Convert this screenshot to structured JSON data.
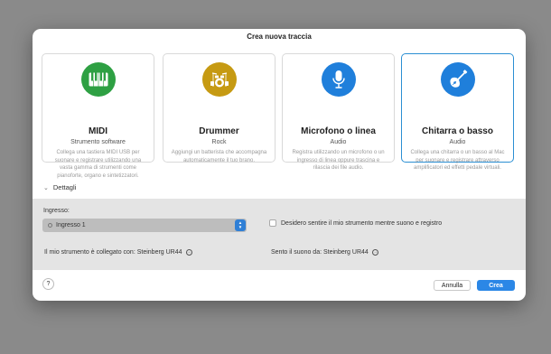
{
  "dialog": {
    "title": "Crea nuova traccia"
  },
  "cards": [
    {
      "title": "MIDI",
      "subtitle": "Strumento software",
      "description": "Collega una tastiera MIDI USB per suonare e registrare utilizzando una vasta gamma di strumenti come pianoforte, organo e sintetizzatori.",
      "icon": "piano-keys-icon",
      "color": "#2ea043"
    },
    {
      "title": "Drummer",
      "subtitle": "Rock",
      "description": "Aggiungi un batterista che accompagna automaticamente il tuo brano.",
      "icon": "drum-kit-icon",
      "color": "#c69a12"
    },
    {
      "title": "Microfono o linea",
      "subtitle": "Audio",
      "description": "Registra utilizzando un microfono o un ingresso di linea oppure trascina e rilascia dei file audio.",
      "icon": "microphone-icon",
      "color": "#1f7fdb"
    },
    {
      "title": "Chitarra o basso",
      "subtitle": "Audio",
      "description": "Collega una chitarra o un basso al Mac per suonare e registrare attraverso amplificatori ed effetti pedale virtuali.",
      "icon": "guitar-icon",
      "color": "#1f7fdb",
      "selected": true
    }
  ],
  "details": {
    "toggle_label": "Dettagli",
    "input_label": "Ingresso:",
    "input_value": "Ingresso 1",
    "monitor_label": "Desidero sentire il mio strumento mentre suono e registro",
    "monitor_checked": false,
    "device_in": "Il mio strumento è collegato con: Steinberg UR44",
    "device_out": "Sento il suono da: Steinberg UR44"
  },
  "footer": {
    "help_label": "?",
    "cancel_label": "Annulla",
    "create_label": "Crea"
  }
}
